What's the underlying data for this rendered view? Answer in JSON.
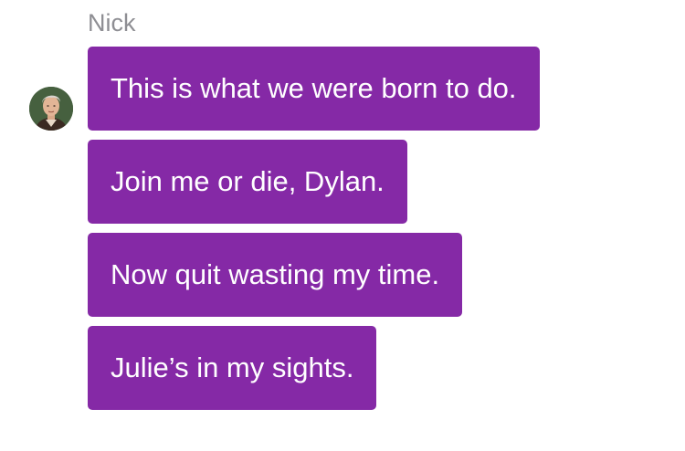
{
  "sender": {
    "name": "Nick",
    "avatar_icon": "person-avatar-icon"
  },
  "colors": {
    "bubble": "#8529a6",
    "bubble_text": "#ffffff",
    "name_text": "#8e8e93"
  },
  "messages": [
    {
      "text": "This is what we were born to do."
    },
    {
      "text": "Join me or die, Dylan."
    },
    {
      "text": "Now quit wasting my time."
    },
    {
      "text": "Julie’s in my sights."
    }
  ]
}
